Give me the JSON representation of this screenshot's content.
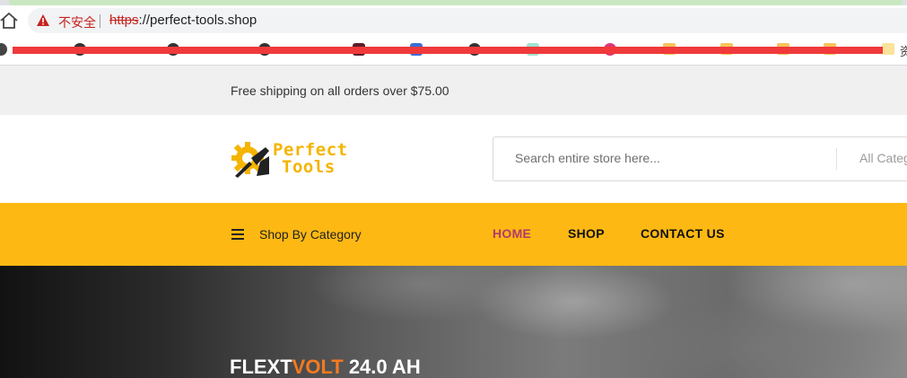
{
  "browser": {
    "insecure_label": "不安全",
    "url_scheme": "https",
    "url_rest": "://perfect-tools.shop",
    "bookmark_overflow": "资"
  },
  "promo": {
    "text": "Free shipping on all orders over $75.00"
  },
  "header": {
    "logo_line1": "Perfect",
    "logo_line2": "Tools",
    "search_placeholder": "Search entire store here...",
    "category_select": "All Categories"
  },
  "nav": {
    "shop_by_category": "Shop By Category",
    "links": [
      {
        "label": "HOME",
        "active": true
      },
      {
        "label": "SHOP",
        "active": false
      },
      {
        "label": "CONTACT US",
        "active": false
      }
    ]
  },
  "hero": {
    "title_part1": "FLEXT",
    "title_accent": "VOLT",
    "title_part2": " 24.0 AH"
  },
  "colors": {
    "brand_yellow": "#fdb813",
    "active_link": "#b23a6a",
    "hero_accent": "#f47a20"
  }
}
